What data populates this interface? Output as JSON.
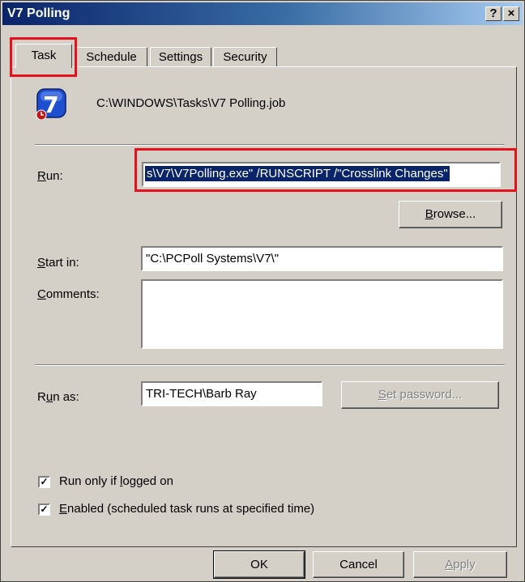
{
  "window": {
    "title": "V7 Polling",
    "help_button": "?",
    "close_button": "×"
  },
  "tabs": [
    {
      "label": "Task",
      "active": true
    },
    {
      "label": "Schedule",
      "active": false
    },
    {
      "label": "Settings",
      "active": false
    },
    {
      "label": "Security",
      "active": false
    }
  ],
  "task": {
    "icon": "app-v7-icon",
    "path": "C:\\WINDOWS\\Tasks\\V7 Polling.job",
    "run_label": "Run:",
    "run_value": "s\\V7\\V7Polling.exe\" /RUNSCRIPT /\"Crosslink Changes\"",
    "browse_label": "Browse...",
    "start_in_label": "Start in:",
    "start_in_value": "\"C:\\PCPoll Systems\\V7\\\"",
    "comments_label": "Comments:",
    "comments_value": "",
    "run_as_label": "Run as:",
    "run_as_value": "TRI-TECH\\Barb Ray",
    "set_password_label": "Set password...",
    "run_only_logged_on_label": "Run only if logged on",
    "run_only_logged_on_checked": true,
    "enabled_label": "Enabled (scheduled task runs at specified time)",
    "enabled_checked": true
  },
  "footer": {
    "ok_label": "OK",
    "cancel_label": "Cancel",
    "apply_label": "Apply"
  },
  "colors": {
    "highlight": "#e8101a",
    "selection": "#0a246a",
    "title_bar": "#0a246a"
  }
}
